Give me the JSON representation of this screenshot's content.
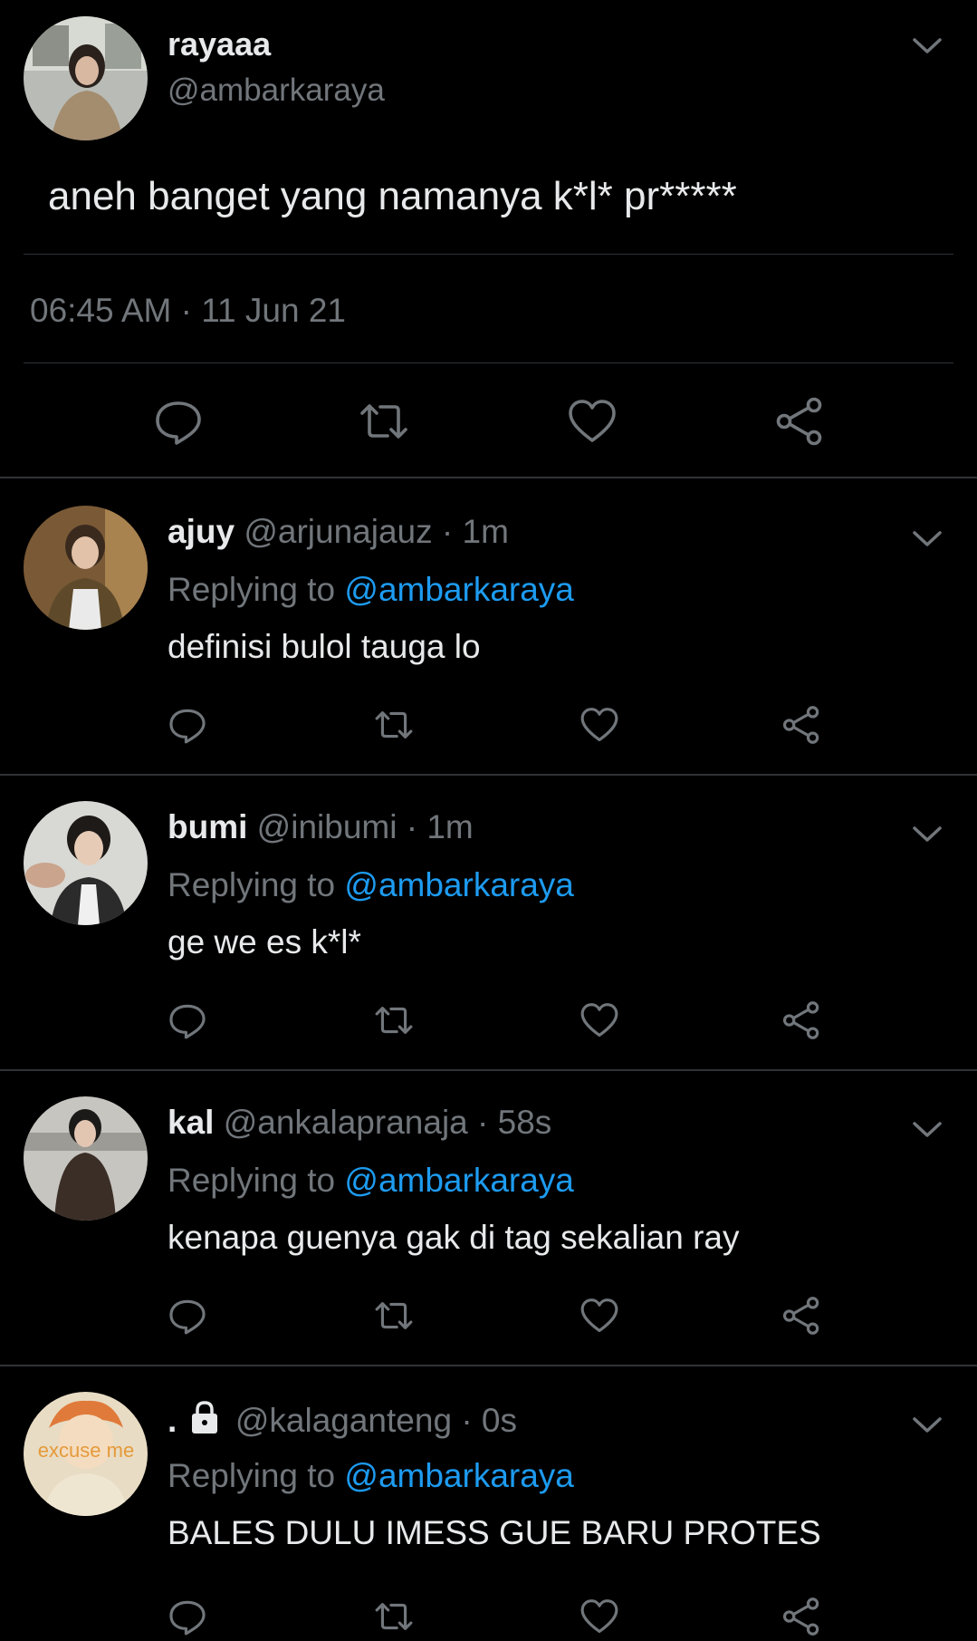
{
  "main_tweet": {
    "name": "rayaaa",
    "handle": "@ambarkaraya",
    "text": "aneh banget yang namanya k*l* pr*****",
    "timestamp": "06:45 AM · 11 Jun 21"
  },
  "replies": [
    {
      "name": "ajuy",
      "handle": "@arjunajauz",
      "time": "1m",
      "replying_label": "Replying to",
      "mention": "@ambarkaraya",
      "text": "definisi bulol tauga lo"
    },
    {
      "name": "bumi",
      "handle": "@inibumi",
      "time": "1m",
      "replying_label": "Replying to",
      "mention": "@ambarkaraya",
      "text": "ge we es k*l*"
    },
    {
      "name": "kal",
      "handle": "@ankalapranaja",
      "time": "58s",
      "replying_label": "Replying to",
      "mention": "@ambarkaraya",
      "text": "kenapa guenya gak di tag sekalian ray"
    },
    {
      "name": ".",
      "handle": "@kalaganteng",
      "time": "0s",
      "replying_label": "Replying to",
      "mention": "@ambarkaraya",
      "text": "BALES DULU IMESS GUE BARU PROTES",
      "avatar_caption": "excuse me"
    }
  ],
  "colors": {
    "background": "#000000",
    "text": "#e7e9ea",
    "secondary": "#71767b",
    "link": "#1d9bf0",
    "divider": "#2f3336"
  },
  "icons": [
    "reply-icon",
    "retweet-icon",
    "like-icon",
    "share-icon",
    "chevron-down-icon",
    "lock-icon"
  ]
}
